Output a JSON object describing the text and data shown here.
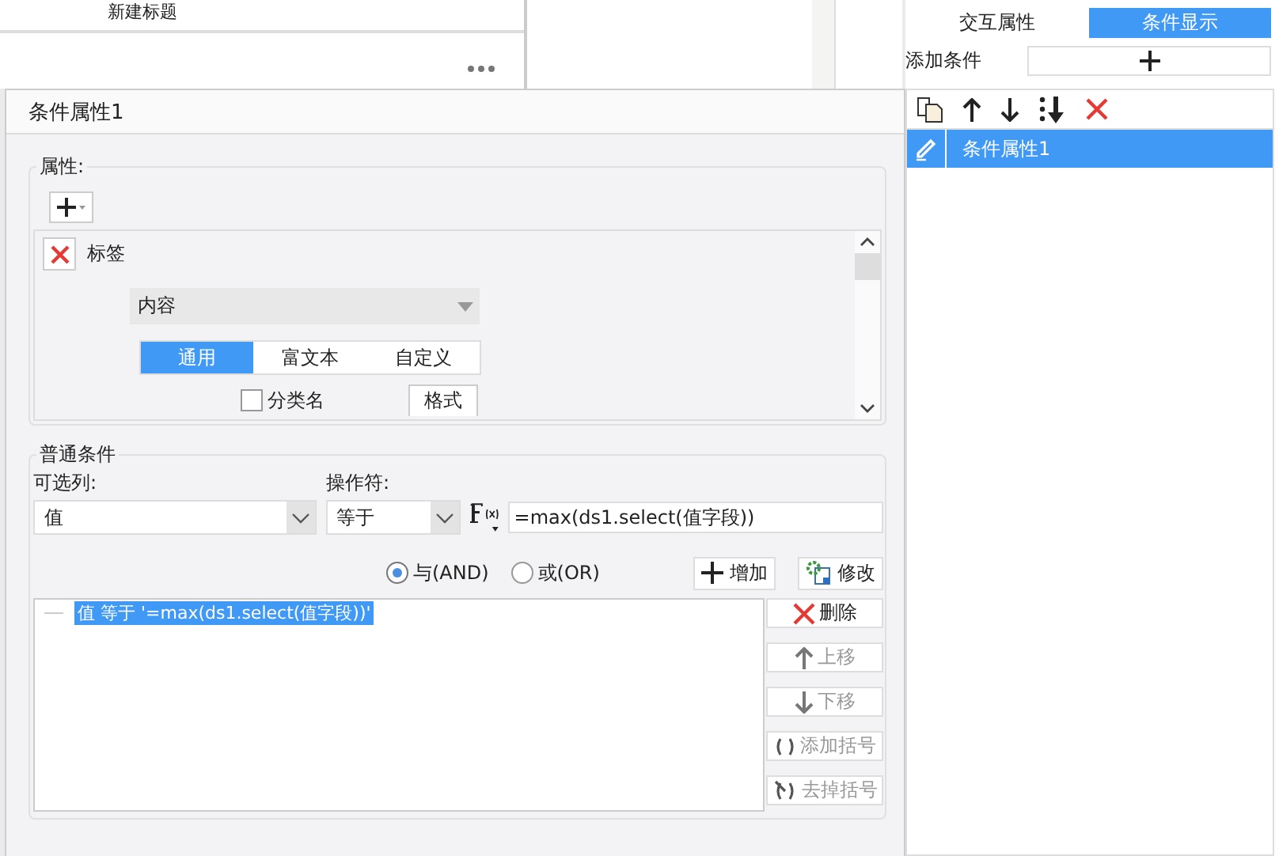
{
  "background": {
    "title": "新建标题"
  },
  "dialog": {
    "title": "条件属性1",
    "properties": {
      "legend": "属性:",
      "items": [
        {
          "label": "标签",
          "content": "内容",
          "tabs": [
            {
              "label": "通用",
              "selected": true
            },
            {
              "label": "富文本",
              "selected": false
            },
            {
              "label": "自定义",
              "selected": false
            }
          ],
          "checkbox": {
            "label": "分类名",
            "checked": false
          },
          "format_button": "格式"
        }
      ]
    },
    "conditions": {
      "legend": "普通条件",
      "column_label": "可选列:",
      "column_value": "值",
      "operator_label": "操作符:",
      "operator_value": "等于",
      "formula": "=max(ds1.select(值字段))",
      "logic": [
        {
          "label": "与(AND)",
          "selected": true
        },
        {
          "label": "或(OR)",
          "selected": false
        }
      ],
      "add_button": "增加",
      "modify_button": "修改",
      "rules": [
        {
          "text": "值 等于 '=max(ds1.select(值字段))'",
          "selected": true
        }
      ],
      "side_buttons": [
        {
          "kind": "delete",
          "label": "删除",
          "disabled": false
        },
        {
          "kind": "up",
          "label": "上移",
          "disabled": true
        },
        {
          "kind": "down",
          "label": "下移",
          "disabled": true
        },
        {
          "kind": "add_paren",
          "label": "添加括号",
          "disabled": true
        },
        {
          "kind": "remove_paren",
          "label": "去掉括号",
          "disabled": true
        }
      ]
    }
  },
  "panel": {
    "tabs": [
      {
        "label": "交互属性",
        "selected": false
      },
      {
        "label": "条件显示",
        "selected": true
      }
    ],
    "add_label": "添加条件",
    "items": [
      {
        "label": "条件属性1",
        "selected": true
      }
    ]
  }
}
